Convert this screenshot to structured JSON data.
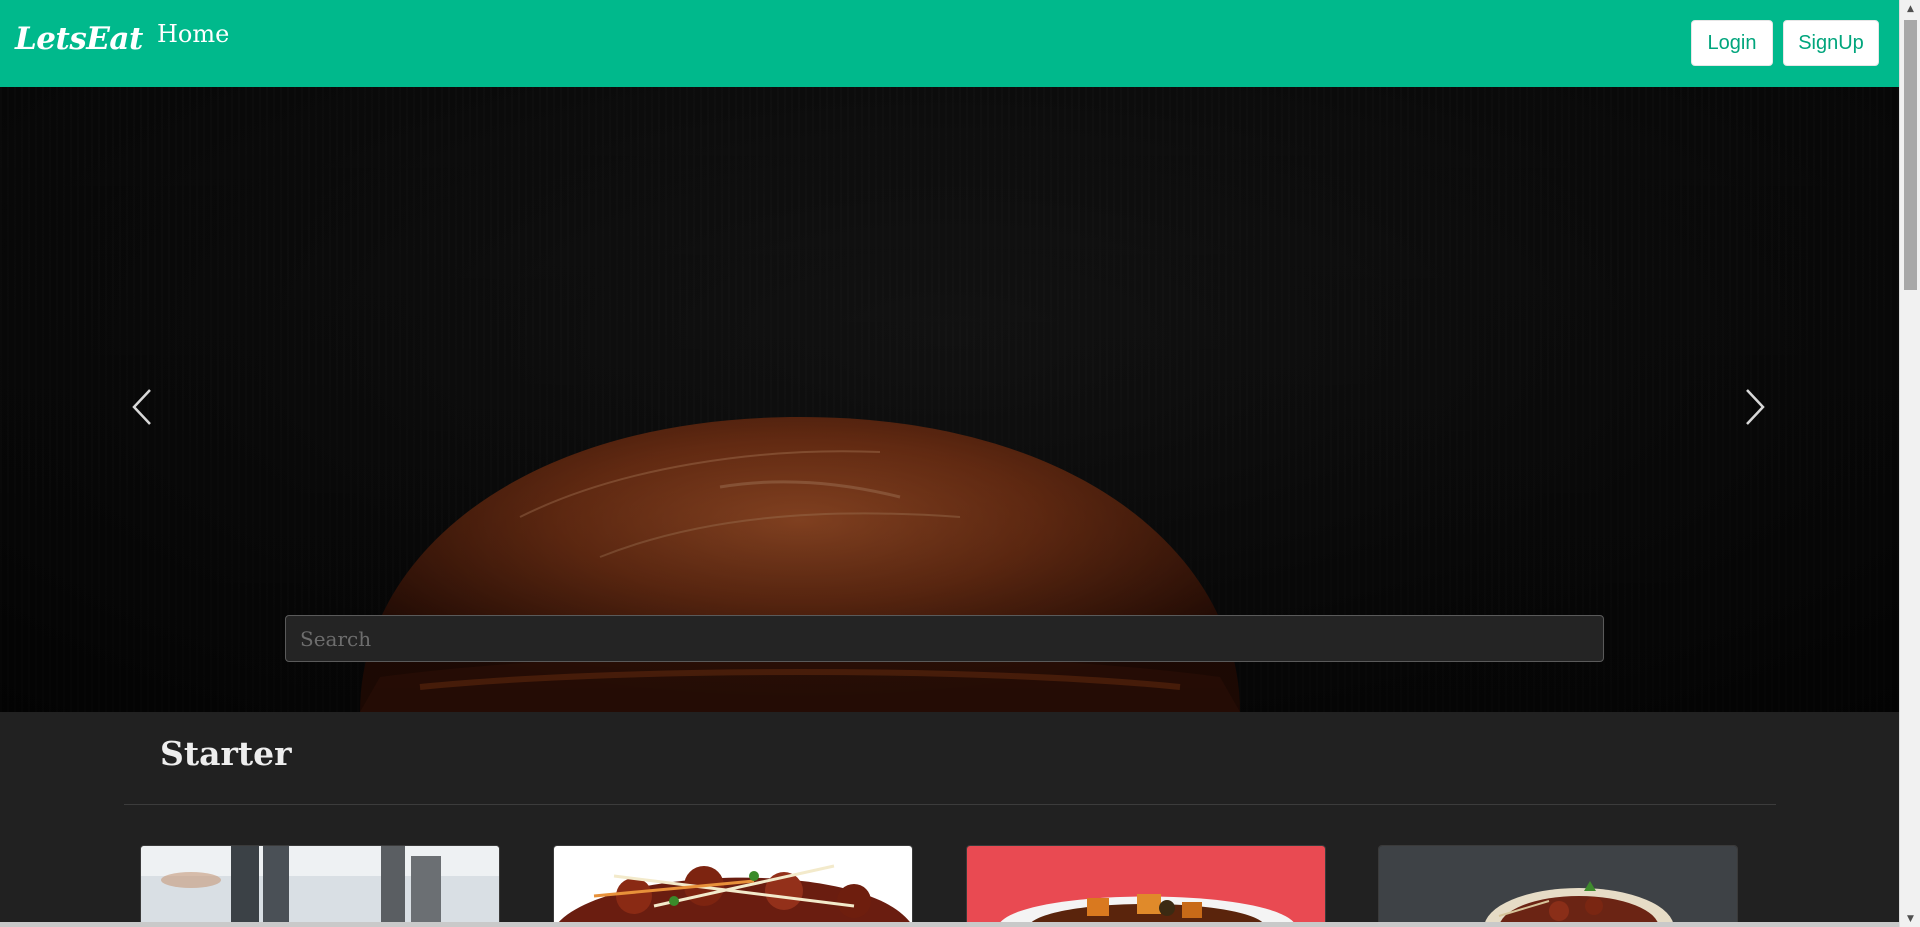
{
  "navbar": {
    "brand": "LetsEat",
    "home_link": "Home",
    "login_label": "Login",
    "signup_label": "SignUp",
    "background_color": "#00b98c"
  },
  "hero": {
    "search_placeholder": "Search",
    "prev_icon": "chevron-left-icon",
    "next_icon": "chevron-right-icon"
  },
  "section": {
    "title": "Starter"
  },
  "cards": [
    {
      "image": "people-outdoor-photo"
    },
    {
      "image": "chilli-chicken-photo"
    },
    {
      "image": "paneer-bowl-photo"
    },
    {
      "image": "kebab-plate-photo"
    }
  ]
}
